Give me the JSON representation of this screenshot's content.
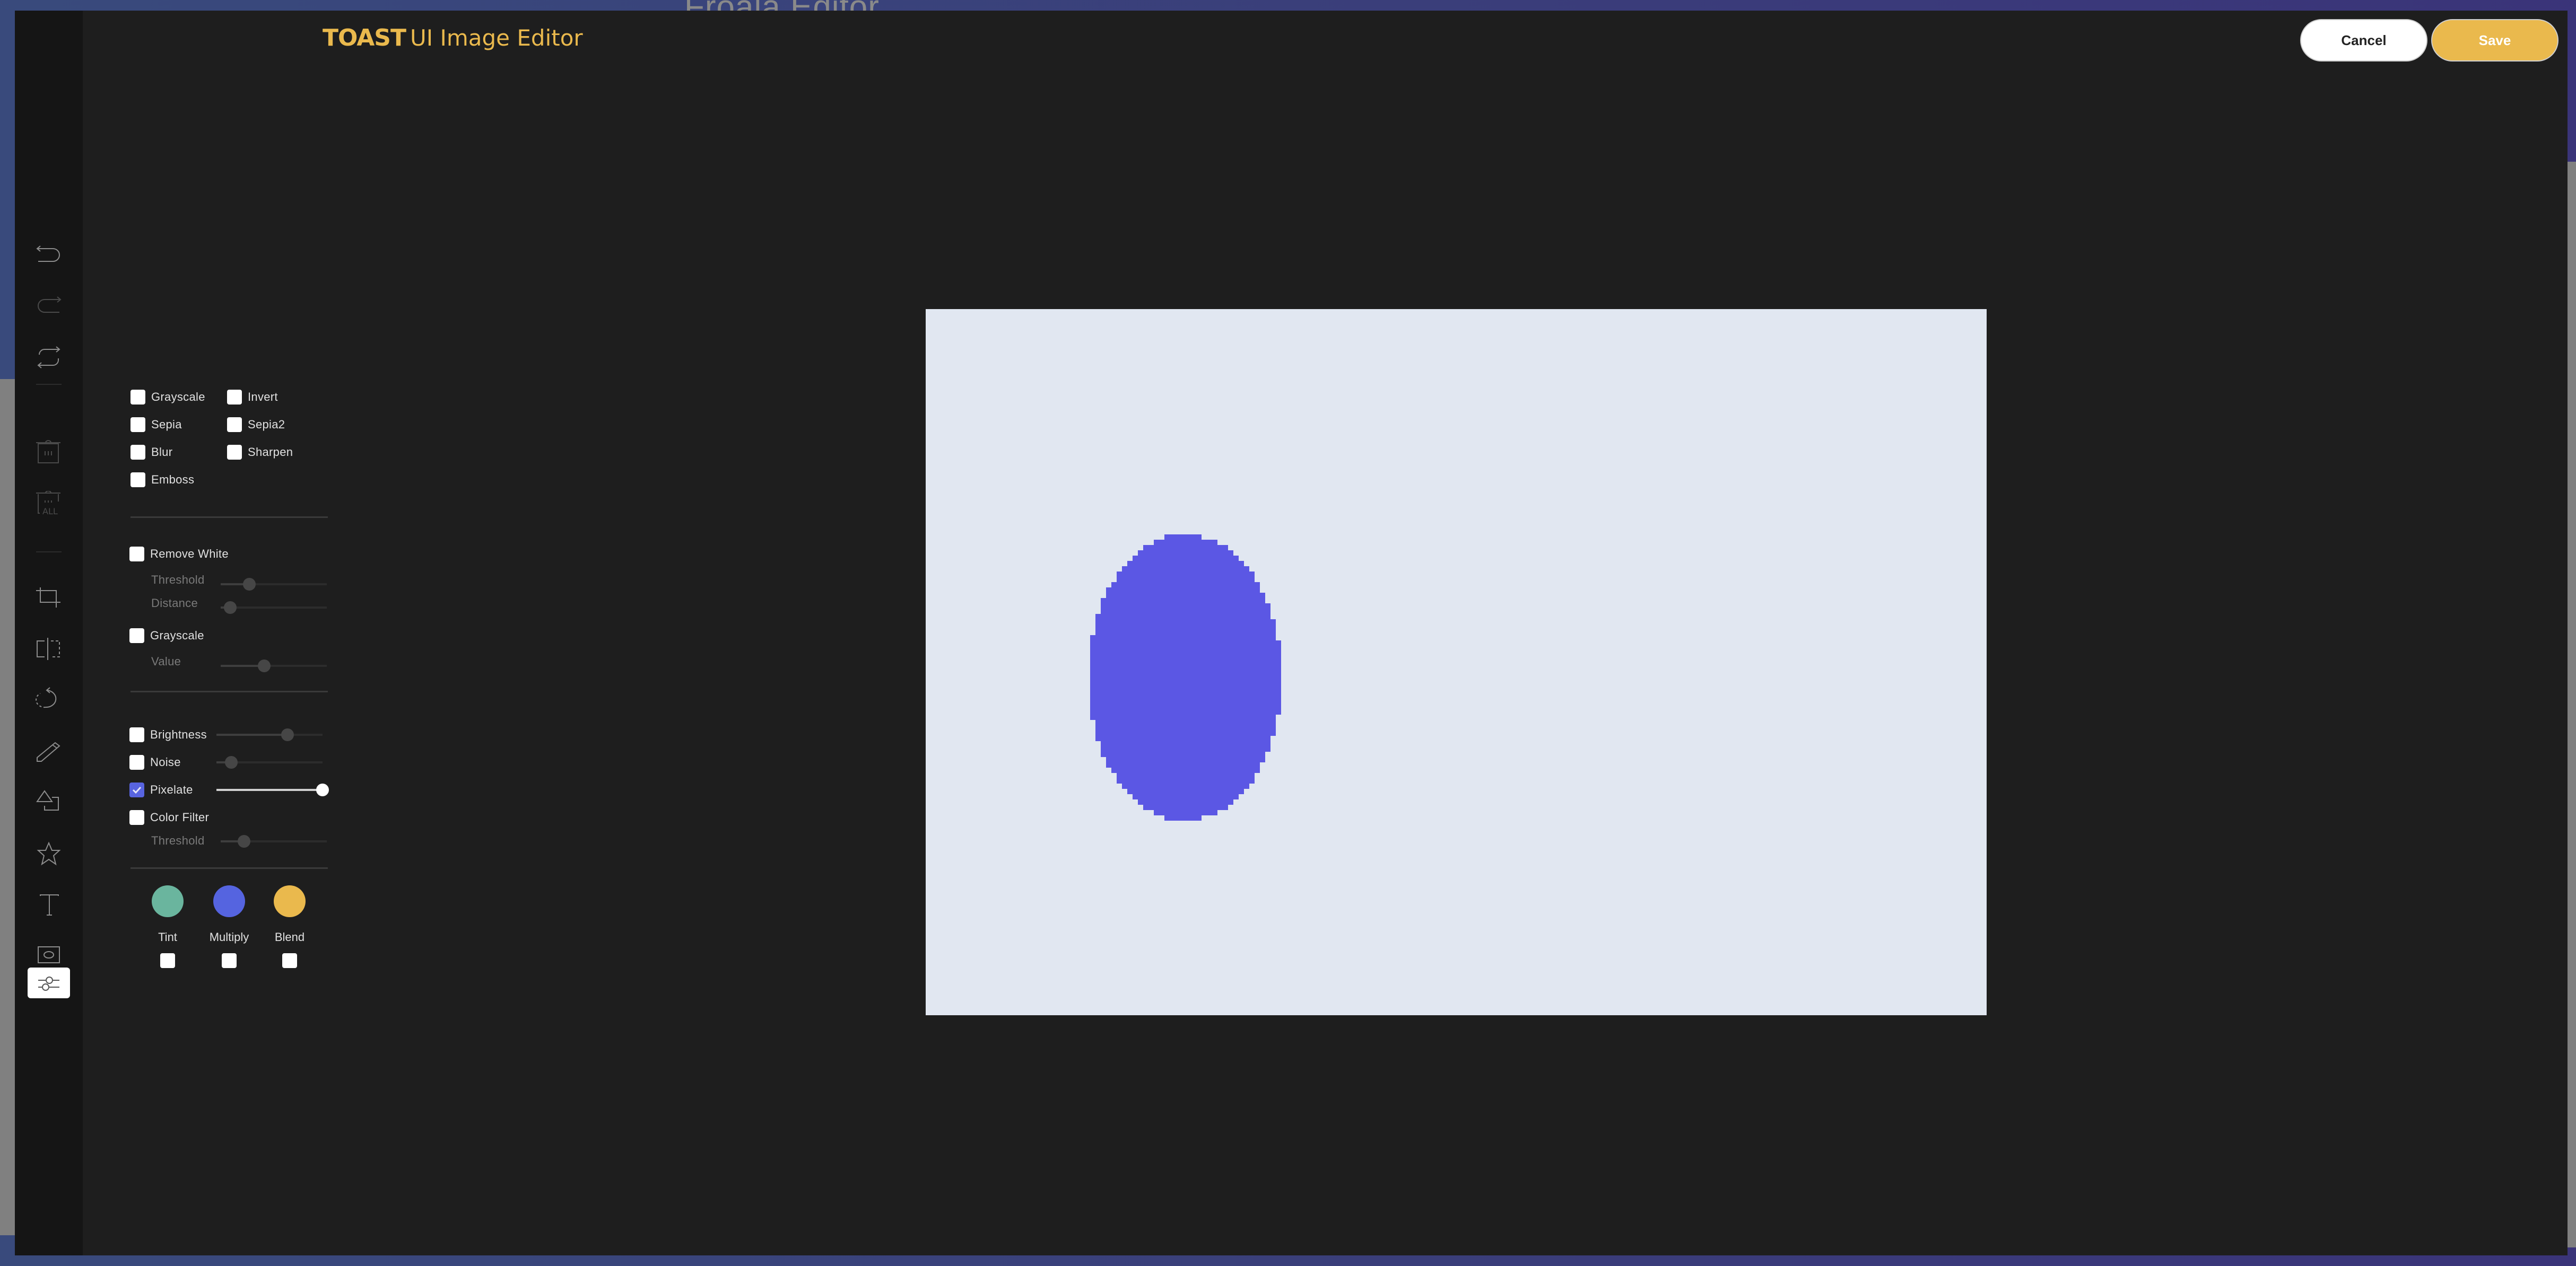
{
  "background": {
    "brand_text": "Froala Editor"
  },
  "header": {
    "logo_text": "TOAST",
    "title_text": "UI Image Editor",
    "cancel_label": "Cancel",
    "save_label": "Save"
  },
  "colors": {
    "accent_yellow": "#eab94d",
    "accent_blue": "#5864e0",
    "modal_bg": "#1e1e1e",
    "sidebar_bg": "#151515",
    "canvas_bg": "#e1e7f1",
    "shape_fill": "#5b57e4"
  },
  "toolbar": {
    "items": [
      {
        "name": "undo",
        "icon": "undo-icon",
        "enabled": true
      },
      {
        "name": "redo",
        "icon": "redo-icon",
        "enabled": false
      },
      {
        "name": "reset",
        "icon": "reset-icon",
        "enabled": true
      },
      {
        "name": "delete",
        "icon": "delete-icon",
        "enabled": false
      },
      {
        "name": "delete-all",
        "icon": "delete-all-icon",
        "enabled": false
      },
      {
        "name": "crop",
        "icon": "crop-icon",
        "enabled": true
      },
      {
        "name": "flip",
        "icon": "flip-icon",
        "enabled": true
      },
      {
        "name": "rotate",
        "icon": "rotate-icon",
        "enabled": true
      },
      {
        "name": "draw",
        "icon": "pencil-icon",
        "enabled": true
      },
      {
        "name": "shape",
        "icon": "shape-icon",
        "enabled": true
      },
      {
        "name": "icon",
        "icon": "star-icon",
        "enabled": true
      },
      {
        "name": "text",
        "icon": "text-icon",
        "enabled": true
      },
      {
        "name": "mask",
        "icon": "mask-icon",
        "enabled": true
      },
      {
        "name": "filter",
        "icon": "filter-icon",
        "enabled": true,
        "active": true
      }
    ],
    "delete_all_text": "ALL"
  },
  "filters": {
    "basic": [
      {
        "label": "Grayscale",
        "checked": false
      },
      {
        "label": "Invert",
        "checked": false
      },
      {
        "label": "Sepia",
        "checked": false
      },
      {
        "label": "Sepia2",
        "checked": false
      },
      {
        "label": "Blur",
        "checked": false
      },
      {
        "label": "Sharpen",
        "checked": false
      },
      {
        "label": "Emboss",
        "checked": false
      }
    ],
    "remove_white": {
      "label": "Remove White",
      "checked": false,
      "threshold_label": "Threshold",
      "threshold_value": 0.27,
      "distance_label": "Distance",
      "distance_value": 0.09
    },
    "grayscale2": {
      "label": "Grayscale",
      "checked": false,
      "value_label": "Value",
      "value": 0.41
    },
    "brightness": {
      "label": "Brightness",
      "checked": false,
      "value": 0.67
    },
    "noise": {
      "label": "Noise",
      "checked": false,
      "value": 0.14
    },
    "pixelate": {
      "label": "Pixelate",
      "checked": true,
      "value": 1.0
    },
    "color_filter": {
      "label": "Color Filter",
      "checked": false,
      "threshold_label": "Threshold",
      "threshold_value": 0.22
    },
    "color_modes": [
      {
        "label": "Tint",
        "color": "#6ab59e",
        "checked": false
      },
      {
        "label": "Multiply",
        "color": "#5564e0",
        "checked": false
      },
      {
        "label": "Blend",
        "color": "#eab94d",
        "checked": false
      }
    ]
  },
  "canvas": {
    "shape": "pixelated-ellipse"
  }
}
